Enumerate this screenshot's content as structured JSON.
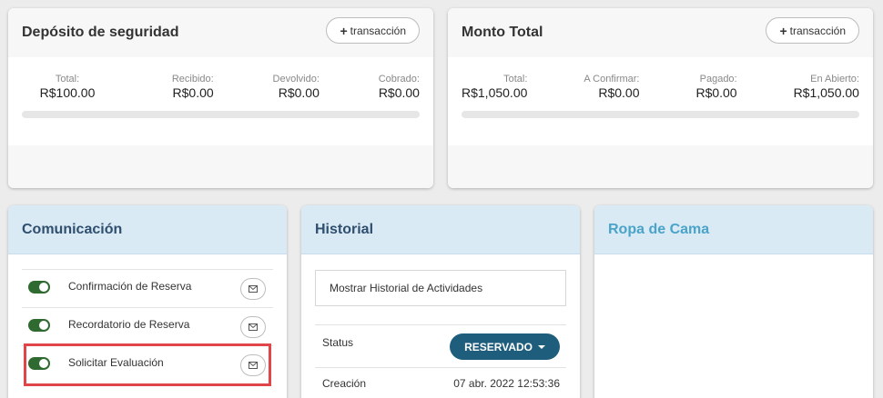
{
  "deposit": {
    "title": "Depósito de seguridad",
    "button_label": "transacción",
    "stats": [
      {
        "label": "Total:",
        "value": "R$100.00"
      },
      {
        "label": "Recibido:",
        "value": "R$0.00"
      },
      {
        "label": "Devolvido:",
        "value": "R$0.00"
      },
      {
        "label": "Cobrado:",
        "value": "R$0.00"
      }
    ]
  },
  "total": {
    "title": "Monto Total",
    "button_label": "transacción",
    "stats": [
      {
        "label": "Total:",
        "value": "R$1,050.00"
      },
      {
        "label": "A Confirmar:",
        "value": "R$0.00"
      },
      {
        "label": "Pagado:",
        "value": "R$0.00"
      },
      {
        "label": "En Abierto:",
        "value": "R$1,050.00"
      }
    ]
  },
  "communication": {
    "title": "Comunicación",
    "items": [
      {
        "label": "Confirmación de Reserva"
      },
      {
        "label": "Recordatorio de Reserva"
      },
      {
        "label": "Solicitar Evaluación"
      }
    ]
  },
  "history": {
    "title": "Historial",
    "show_button": "Mostrar Historial de Actividades",
    "status_label": "Status",
    "status_value": "RESERVADO",
    "created_label": "Creación",
    "created_value": "07 abr. 2022 12:53:36"
  },
  "bedding": {
    "title": "Ropa de Cama"
  },
  "colors": {
    "toggle_on": "#2f6b30",
    "status_button": "#1f5d7c",
    "highlight": "#e0454a",
    "panel_header": "#daeaf5"
  },
  "icons": [
    "plus-icon",
    "mail-icon",
    "toggle-switch",
    "caret-down-icon"
  ]
}
